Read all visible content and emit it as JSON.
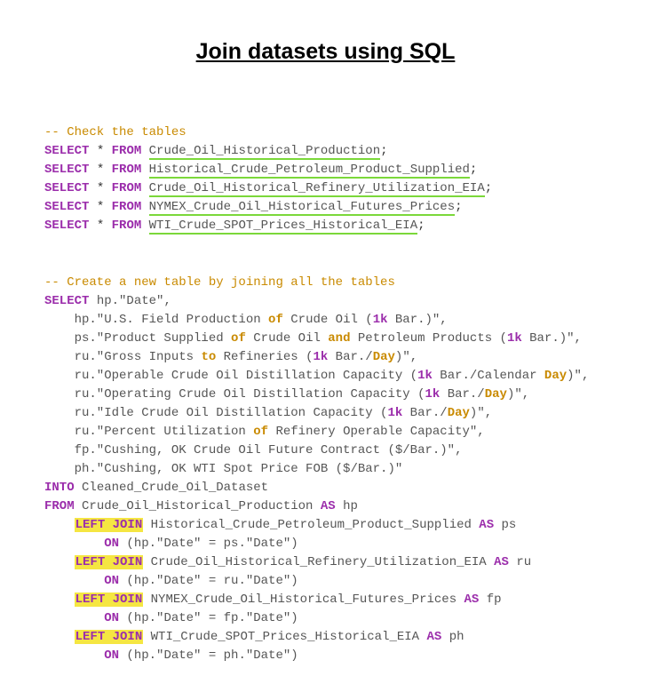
{
  "title": "Join datasets using SQL",
  "comment1": "-- Check the tables",
  "check": [
    {
      "kw1": "SELECT",
      "star": "*",
      "kw2": "FROM",
      "table": "Crude_Oil_Historical_Production"
    },
    {
      "kw1": "SELECT",
      "star": "*",
      "kw2": "FROM",
      "table": "Historical_Crude_Petroleum_Product_Supplied"
    },
    {
      "kw1": "SELECT",
      "star": "*",
      "kw2": "FROM",
      "table": "Crude_Oil_Historical_Refinery_Utilization_EIA"
    },
    {
      "kw1": "SELECT",
      "star": "*",
      "kw2": "FROM",
      "table": "NYMEX_Crude_Oil_Historical_Futures_Prices"
    },
    {
      "kw1": "SELECT",
      "star": "*",
      "kw2": "FROM",
      "table": "WTI_Crude_SPOT_Prices_Historical_EIA"
    }
  ],
  "comment2": "-- Create a new table by joining all the tables",
  "main": {
    "kwSelect": "SELECT",
    "hpDate": "hp.\"Date\",",
    "col1": {
      "pre": "    hp.\"U.S. Field Production ",
      "kw1": "of",
      "mid1": " Crude Oil (",
      "num1": "1k",
      "post1": " Bar.)\","
    },
    "col2": {
      "pre": "    ps.\"Product Supplied ",
      "kw1": "of",
      "mid1": " Crude Oil ",
      "kw2": "and",
      "mid2": " Petroleum Products (",
      "num1": "1k",
      "post1": " Bar.)\","
    },
    "col3": {
      "pre": "    ru.\"Gross Inputs ",
      "kw1": "to",
      "mid1": " Refineries (",
      "num1": "1k",
      "mid2": " Bar./",
      "kw2": "Day",
      "post1": ")\","
    },
    "col4": {
      "pre": "    ru.\"Operable Crude Oil Distillation Capacity (",
      "num1": "1k",
      "mid1": " Bar./Calendar ",
      "kw1": "Day",
      "post1": ")\","
    },
    "col5": {
      "pre": "    ru.\"Operating Crude Oil Distillation Capacity (",
      "num1": "1k",
      "mid1": " Bar./",
      "kw1": "Day",
      "post1": ")\","
    },
    "col6": {
      "pre": "    ru.\"Idle Crude Oil Distillation Capacity (",
      "num1": "1k",
      "mid1": " Bar./",
      "kw1": "Day",
      "post1": ")\","
    },
    "col7": {
      "pre": "    ru.\"Percent Utilization ",
      "kw1": "of",
      "post1": " Refinery Operable Capacity\","
    },
    "col8": "    fp.\"Cushing, OK Crude Oil Future Contract ($/Bar.)\",",
    "col9": "    ph.\"Cushing, OK WTI Spot Price FOB ($/Bar.)\"",
    "kwInto": "INTO",
    "intoTable": " Cleaned_Crude_Oil_Dataset",
    "kwFrom": "FROM",
    "fromTable": " Crude_Oil_Historical_Production ",
    "kwAs": "AS",
    "fromAlias": " hp",
    "joins": [
      {
        "kwJoin": "LEFT JOIN",
        "table": " Historical_Crude_Petroleum_Product_Supplied ",
        "kwAs": "AS",
        "alias": " ps",
        "kwOn": "ON",
        "cond": " (hp.\"Date\" = ps.\"Date\")"
      },
      {
        "kwJoin": "LEFT JOIN",
        "table": " Crude_Oil_Historical_Refinery_Utilization_EIA ",
        "kwAs": "AS",
        "alias": " ru",
        "kwOn": "ON",
        "cond": " (hp.\"Date\" = ru.\"Date\")"
      },
      {
        "kwJoin": "LEFT JOIN",
        "table": " NYMEX_Crude_Oil_Historical_Futures_Prices ",
        "kwAs": "AS",
        "alias": " fp",
        "kwOn": "ON",
        "cond": " (hp.\"Date\" = fp.\"Date\")"
      },
      {
        "kwJoin": "LEFT JOIN",
        "table": " WTI_Crude_SPOT_Prices_Historical_EIA ",
        "kwAs": "AS",
        "alias": " ph",
        "kwOn": "ON",
        "cond": " (hp.\"Date\" = ph.\"Date\")"
      }
    ]
  }
}
